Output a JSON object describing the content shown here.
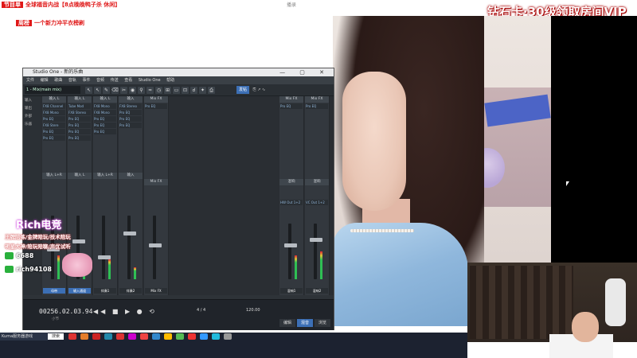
{
  "window_title": "播录",
  "ticker": {
    "tag": "节目单",
    "text": "全球福音内战【8点晚晚鸭子杀 休闲】"
  },
  "ticker2": {
    "tag": "周榜",
    "text": "一个新力冲平衣榜刷"
  },
  "banner": {
    "text": "钻石卡·30级领取房间VIP"
  },
  "daw": {
    "title": "Studio One - 新的乐曲",
    "window_buttons": "— ▢ ✕",
    "menu": [
      "文件",
      "编辑",
      "歌曲",
      "音轨",
      "事件",
      "音频",
      "传送",
      "查看",
      "Studio One",
      "帮助"
    ],
    "preset": "1 - Mix(main mix)",
    "tools": [
      "↖",
      "↖",
      "✎",
      "⌫",
      "✂",
      "◉",
      "⚲",
      "≈",
      "◷",
      "⊞",
      "▭",
      "⊡",
      "☌",
      "✦",
      "⎙"
    ],
    "toolbar_right": {
      "button": "发帖",
      "labels": [
        "⎘",
        "↗",
        "∿"
      ]
    },
    "left_rail": [
      "输入",
      "输出",
      "外部",
      "乐器"
    ],
    "strips": [
      {
        "header": "输入 L",
        "slots": [
          "FX8 Channel",
          "FX8 Mono",
          "Pro EQ",
          "FX8 Stere",
          "Pro EQ",
          "Pro EQ"
        ],
        "label": "输入 L+R",
        "name": "母带"
      },
      {
        "header": "输入 L",
        "slots": [
          "Tube Mod",
          "FX8 Stereo",
          "Pro EQ",
          "Pro EQ",
          "Pro EQ",
          "Pro EQ"
        ],
        "label": "输入 L",
        "name": "输入通道"
      },
      {
        "header": "输入 L",
        "slots": [
          "FX8 Mono",
          "FX8 Mono",
          "Pro EQ",
          "Pro EQ",
          "Pro EQ"
        ],
        "label": "输入 L+R",
        "name": "伴奏1"
      },
      {
        "header": "输入",
        "slots": [
          "FX8 Stereo",
          "Pro EQ",
          "Pro EQ",
          "Pro EQ"
        ],
        "label": "输入",
        "name": "伴奏2"
      },
      {
        "header": "Mix FX",
        "slots": [
          "Pro EQ"
        ],
        "label": "Mix FX",
        "name": "Mix FX"
      },
      {
        "header": "Mix FX",
        "slots": [
          "Pro EQ"
        ],
        "label": "混响",
        "name": "混响1"
      },
      {
        "header": "Mix FX",
        "slots": [
          "Pro EQ"
        ],
        "label": "混响",
        "name": "混响2"
      }
    ],
    "bus_labels": [
      "HW Out 1+2",
      "VC Out 1+2"
    ],
    "time": "00256.02.03.94",
    "time_sub": "小节",
    "transport_buttons": "◀◀ ■ ▶ ● ⟲",
    "signature": "4 / 4",
    "tempo": "120.00",
    "tabs": [
      {
        "label": "编辑",
        "on": false
      },
      {
        "label": "混音",
        "on": true
      },
      {
        "label": "浏览",
        "on": false
      }
    ]
  },
  "streamer": {
    "name": "Rich电竞",
    "line1": "王牌陪练/金牌陪玩/技术陪玩",
    "line2": "明星大神/陪玩陪聊/声优试听",
    "wechat_label": "6688",
    "id_label": "rich94108"
  },
  "taskbar": {
    "app": "Kuma服务器游戏",
    "search": "搜索",
    "icon_colors": [
      "#d33",
      "#e57d2a",
      "#c22",
      "#28a",
      "#d33",
      "#c0c",
      "#e44",
      "#38c",
      "#fb0",
      "#5b5",
      "#e33",
      "#39f",
      "#2bd",
      "#999"
    ]
  }
}
